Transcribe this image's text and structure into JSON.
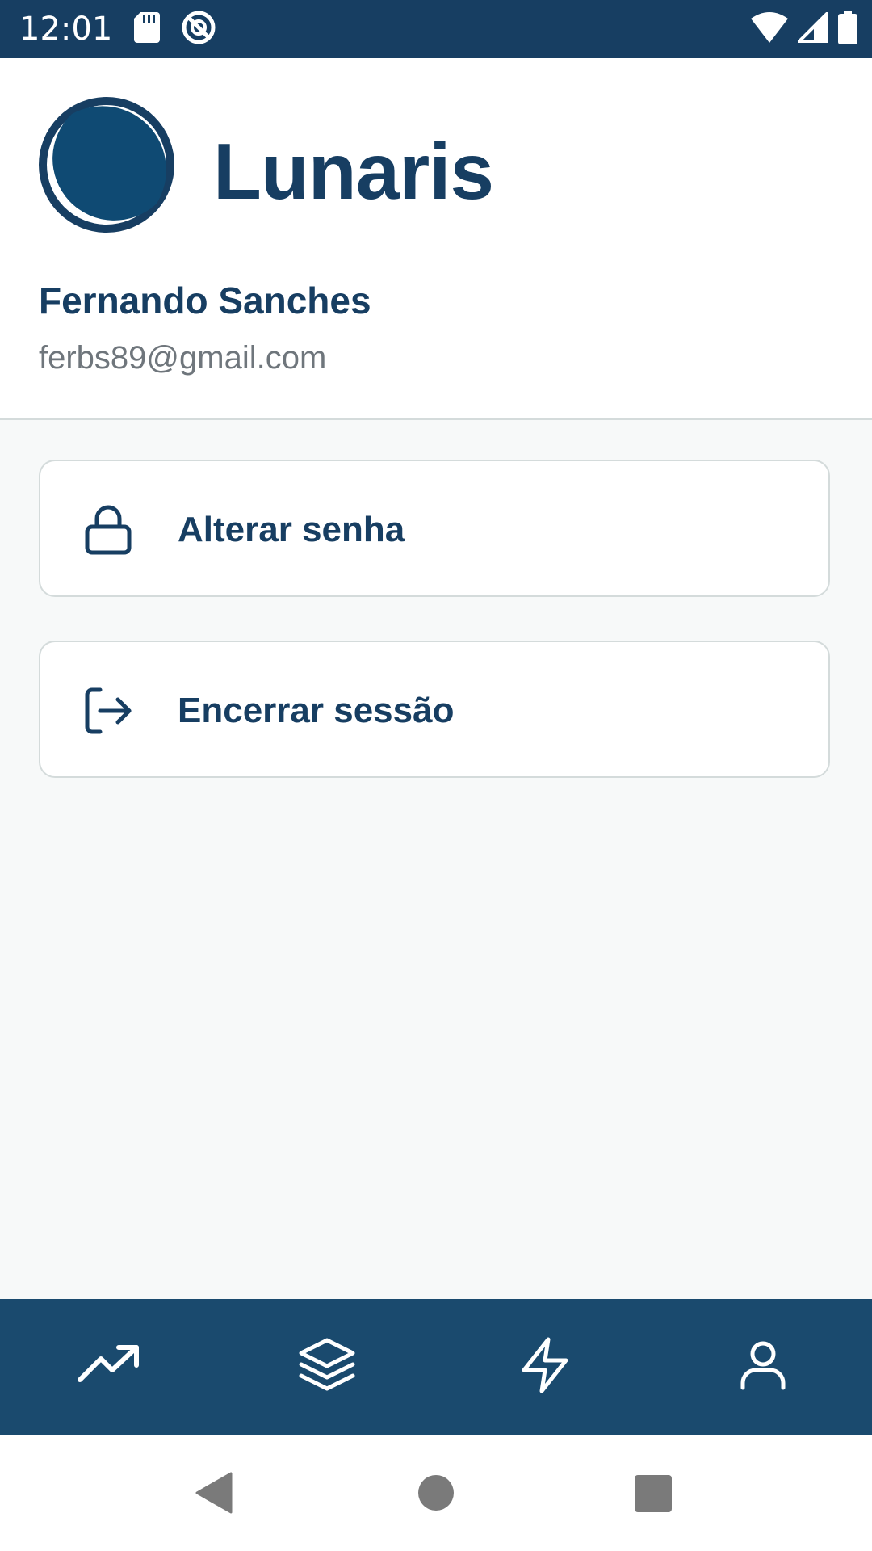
{
  "status_bar": {
    "time": "12:01",
    "icons": [
      "sd-card-icon",
      "do-not-disturb-icon",
      "wifi-icon",
      "cell-signal-icon",
      "battery-icon"
    ]
  },
  "header": {
    "app_name": "Lunaris",
    "logo_icon": "moon-logo-icon",
    "user_name": "Fernando Sanches",
    "user_email": "ferbs89@gmail.com"
  },
  "menu": {
    "items": [
      {
        "label": "Alterar senha",
        "icon": "lock-icon"
      },
      {
        "label": "Encerrar sessão",
        "icon": "logout-icon"
      }
    ]
  },
  "bottom_nav": {
    "items": [
      {
        "icon": "trending-up-icon"
      },
      {
        "icon": "layers-icon"
      },
      {
        "icon": "lightning-icon"
      },
      {
        "icon": "user-icon"
      }
    ]
  },
  "system_nav": {
    "buttons": [
      "back-icon",
      "home-icon",
      "recents-icon"
    ]
  },
  "colors": {
    "primary": "#173e62",
    "nav_background": "#1a4a6e",
    "background": "#f7f9f9",
    "card_border": "#d4dbdb",
    "secondary_text": "#6f767c"
  }
}
